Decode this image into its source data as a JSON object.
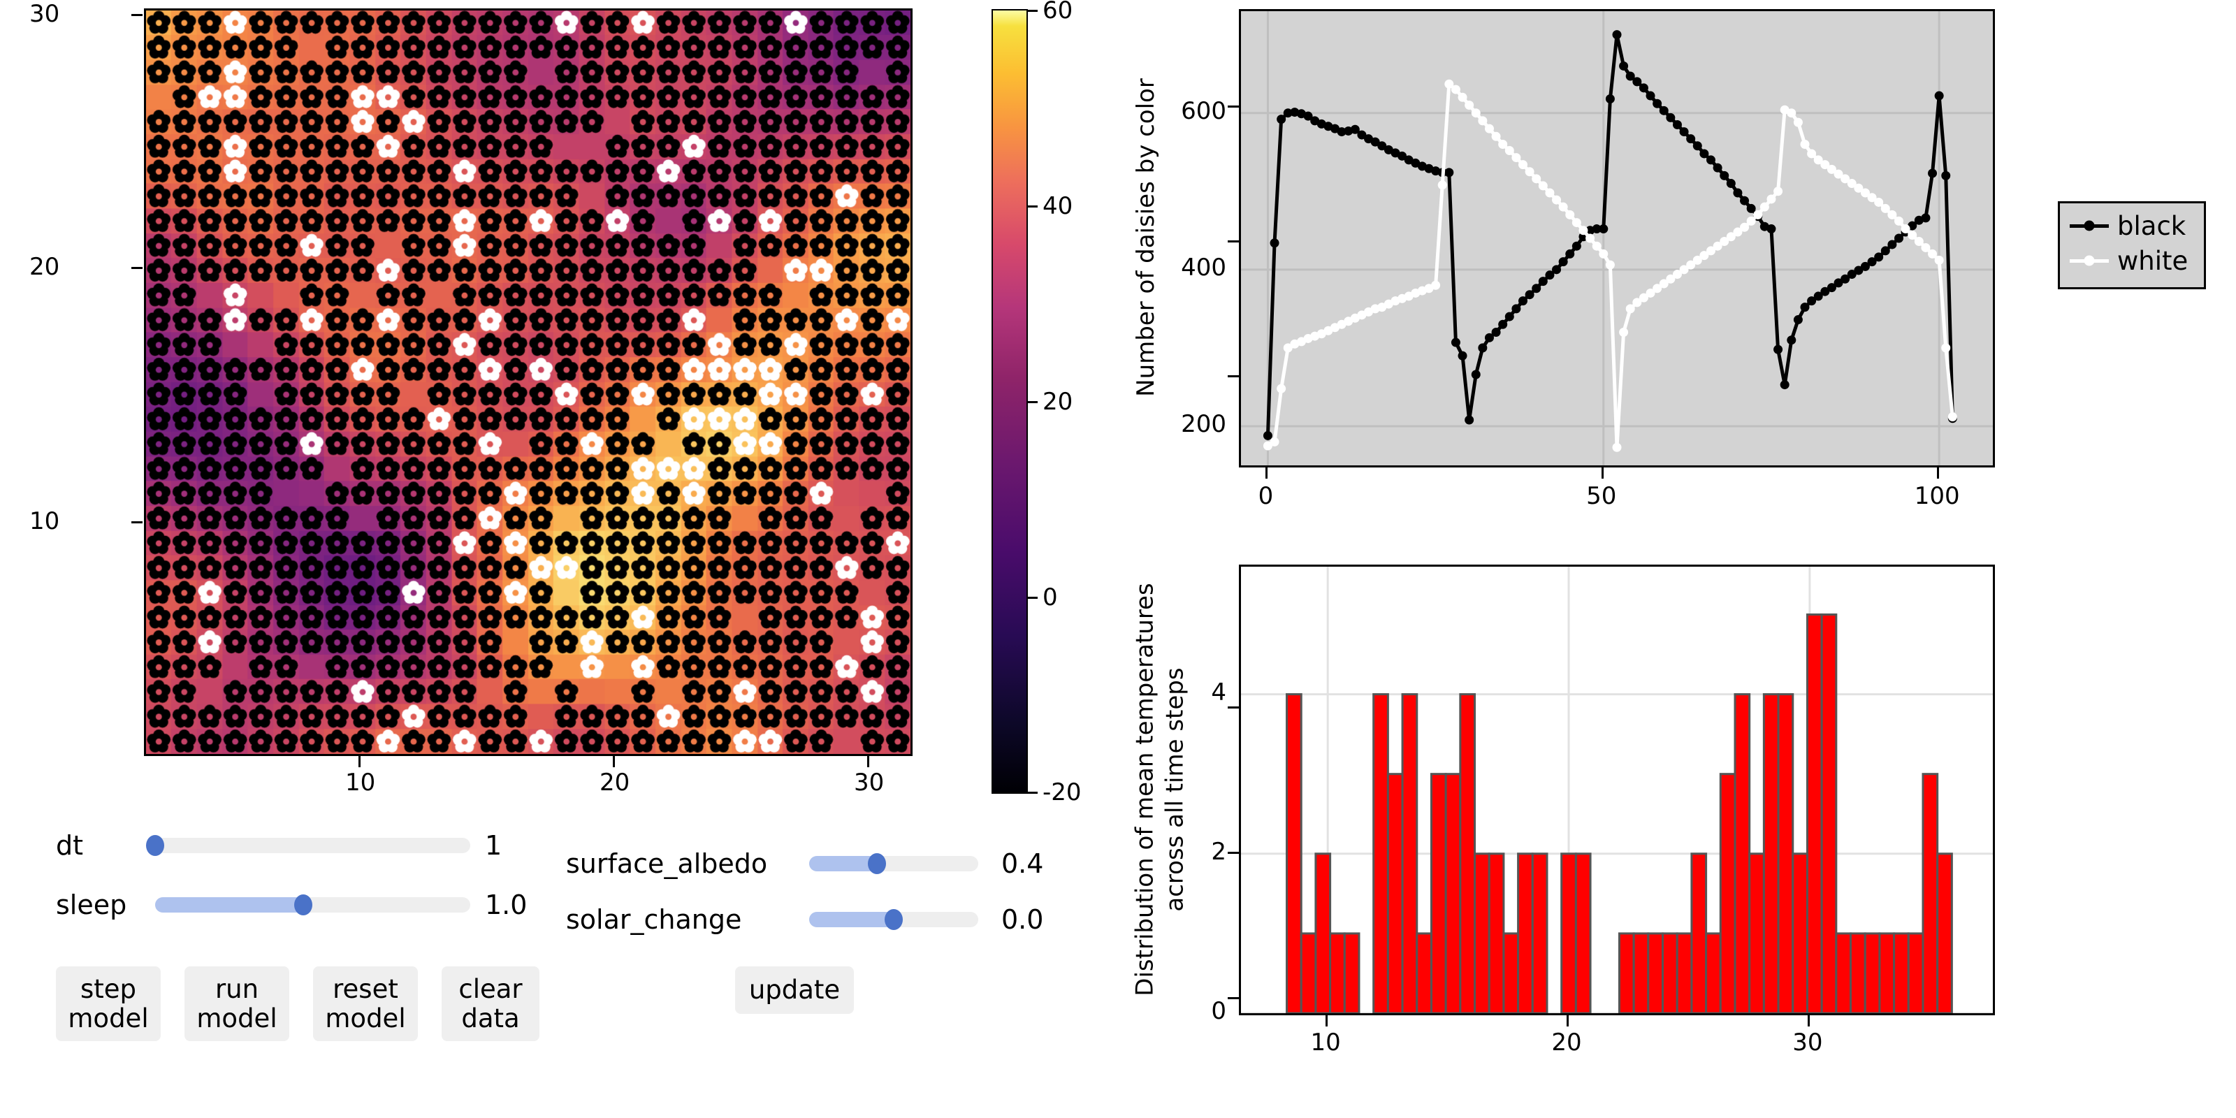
{
  "heatmap": {
    "name": "daisyworld-grid",
    "xticks": [
      "10",
      "20",
      "30"
    ],
    "yticks": [
      "30",
      "20",
      "10"
    ],
    "grid_size": 30,
    "daisy_black_color": "#000000",
    "daisy_white_color": "#ffffff"
  },
  "colorbar": {
    "name": "temperature-colorbar",
    "ticks": [
      "60",
      "40",
      "20",
      "0",
      "-20"
    ],
    "vmin": -20,
    "vmax": 60,
    "colormap": "magma"
  },
  "controls": {
    "sliders": [
      {
        "label": "dt",
        "value": "1",
        "fill_ratio": 0.0
      },
      {
        "label": "sleep",
        "value": "1.0",
        "fill_ratio": 0.47
      },
      {
        "label": "surface_albedo",
        "value": "0.4",
        "fill_ratio": 0.4
      },
      {
        "label": "solar_change",
        "value": "0.0",
        "fill_ratio": 0.5
      }
    ],
    "buttons": [
      {
        "name": "step-model-button",
        "line1": "step",
        "line2": "model"
      },
      {
        "name": "run-model-button",
        "line1": "run",
        "line2": "model"
      },
      {
        "name": "reset-model-button",
        "line1": "reset",
        "line2": "model"
      },
      {
        "name": "clear-data-button",
        "line1": "clear",
        "line2": "data"
      },
      {
        "name": "update-button",
        "line1": "update",
        "line2": ""
      }
    ]
  },
  "chart_data": [
    {
      "type": "line",
      "name": "daisy-population-chart",
      "title": "",
      "xlabel": "",
      "ylabel": "Number of daisies by color",
      "xticks": [
        0,
        50,
        100
      ],
      "yticks": [
        200,
        400,
        600
      ],
      "xlim": [
        -4,
        108
      ],
      "ylim": [
        150,
        730
      ],
      "grid": true,
      "plot_bgcolor": "#d3d3d3",
      "legend_position": "right",
      "series": [
        {
          "name": "black",
          "color": "#000000",
          "x": [
            0,
            1,
            2,
            3,
            4,
            5,
            6,
            7,
            8,
            9,
            10,
            11,
            12,
            13,
            14,
            15,
            16,
            17,
            18,
            19,
            20,
            21,
            22,
            23,
            24,
            25,
            26,
            27,
            28,
            29,
            30,
            31,
            32,
            33,
            34,
            35,
            36,
            37,
            38,
            39,
            40,
            41,
            42,
            43,
            44,
            45,
            46,
            47,
            48,
            49,
            50,
            51,
            52,
            53,
            54,
            55,
            56,
            57,
            58,
            59,
            60,
            61,
            62,
            63,
            64,
            65,
            66,
            67,
            68,
            69,
            70,
            71,
            72,
            73,
            74,
            75,
            76,
            77,
            78,
            79,
            80,
            81,
            82,
            83,
            84,
            85,
            86,
            87,
            88,
            89,
            90,
            91,
            92,
            93,
            94,
            95,
            96,
            97,
            98,
            99,
            100,
            101,
            102
          ],
          "values": [
            188,
            434,
            592,
            600,
            601,
            599,
            596,
            590,
            586,
            583,
            580,
            576,
            577,
            579,
            572,
            567,
            563,
            558,
            553,
            549,
            545,
            540,
            536,
            532,
            529,
            526,
            524,
            524,
            307,
            290,
            208,
            266,
            300,
            313,
            320,
            330,
            340,
            350,
            360,
            368,
            376,
            385,
            393,
            400,
            410,
            420,
            430,
            442,
            450,
            452,
            452,
            618,
            700,
            660,
            647,
            640,
            632,
            622,
            612,
            603,
            594,
            585,
            576,
            567,
            558,
            548,
            540,
            530,
            520,
            510,
            498,
            488,
            478,
            468,
            455,
            452,
            298,
            253,
            310,
            336,
            352,
            360,
            366,
            372,
            377,
            383,
            388,
            394,
            399,
            404,
            410,
            416,
            424,
            432,
            440,
            448,
            456,
            463,
            466,
            523,
            622,
            520,
            210
          ]
        },
        {
          "name": "white",
          "color": "#ffffff",
          "x": [
            0,
            1,
            2,
            3,
            4,
            5,
            6,
            7,
            8,
            9,
            10,
            11,
            12,
            13,
            14,
            15,
            16,
            17,
            18,
            19,
            20,
            21,
            22,
            23,
            24,
            25,
            26,
            27,
            28,
            29,
            30,
            31,
            32,
            33,
            34,
            35,
            36,
            37,
            38,
            39,
            40,
            41,
            42,
            43,
            44,
            45,
            46,
            47,
            48,
            49,
            50,
            51,
            52,
            53,
            54,
            55,
            56,
            57,
            58,
            59,
            60,
            61,
            62,
            63,
            64,
            65,
            66,
            67,
            68,
            69,
            70,
            71,
            72,
            73,
            74,
            75,
            76,
            77,
            78,
            79,
            80,
            81,
            82,
            83,
            84,
            85,
            86,
            87,
            88,
            89,
            90,
            91,
            92,
            93,
            94,
            95,
            96,
            97,
            98,
            99,
            100,
            101,
            102
          ],
          "values": [
            175,
            180,
            248,
            300,
            305,
            308,
            312,
            315,
            318,
            322,
            326,
            330,
            334,
            338,
            342,
            346,
            350,
            352,
            356,
            360,
            363,
            366,
            370,
            373,
            376,
            380,
            508,
            637,
            630,
            620,
            610,
            600,
            590,
            580,
            570,
            560,
            552,
            543,
            534,
            525,
            516,
            507,
            498,
            489,
            480,
            470,
            460,
            450,
            440,
            430,
            420,
            406,
            173,
            320,
            350,
            358,
            364,
            370,
            376,
            382,
            388,
            394,
            400,
            406,
            412,
            418,
            424,
            430,
            436,
            442,
            448,
            454,
            462,
            470,
            480,
            490,
            500,
            604,
            600,
            588,
            560,
            548,
            540,
            534,
            528,
            522,
            516,
            510,
            504,
            498,
            492,
            486,
            478,
            470,
            462,
            452,
            444,
            436,
            428,
            420,
            412,
            300,
            212
          ]
        }
      ]
    },
    {
      "type": "bar",
      "name": "temperature-histogram",
      "title": "",
      "xlabel": "",
      "ylabel": "Distribution of mean temperatures across all time steps",
      "xticks": [
        10,
        20,
        30
      ],
      "yticks": [
        0,
        2,
        4
      ],
      "xlim": [
        6.4,
        37.6
      ],
      "ylim": [
        0,
        5.6
      ],
      "grid": true,
      "bar_color": "#ff0000",
      "bar_edge_color": "#555555",
      "bin_centers": [
        8.6,
        9.2,
        9.8,
        10.4,
        11.0,
        11.6,
        12.2,
        12.8,
        13.4,
        14.0,
        14.6,
        15.2,
        15.8,
        16.4,
        17.0,
        17.6,
        18.2,
        18.8,
        19.4,
        20.0,
        20.6,
        21.2,
        21.8,
        22.4,
        23.0,
        23.6,
        24.2,
        24.8,
        25.4,
        26.0,
        26.6,
        27.2,
        27.8,
        28.4,
        29.0,
        29.6,
        30.2,
        30.8,
        31.4,
        32.0,
        32.6,
        33.2,
        33.8,
        34.4,
        35.0,
        35.6,
        36.2
      ],
      "values": [
        4,
        1,
        2,
        1,
        1,
        0,
        4,
        3,
        4,
        1,
        3,
        3,
        4,
        2,
        2,
        1,
        2,
        2,
        0,
        2,
        2,
        0,
        0,
        1,
        1,
        1,
        1,
        1,
        2,
        1,
        3,
        4,
        2,
        4,
        4,
        2,
        5,
        5,
        1,
        1,
        1,
        1,
        1,
        1,
        3,
        2,
        0
      ]
    }
  ]
}
